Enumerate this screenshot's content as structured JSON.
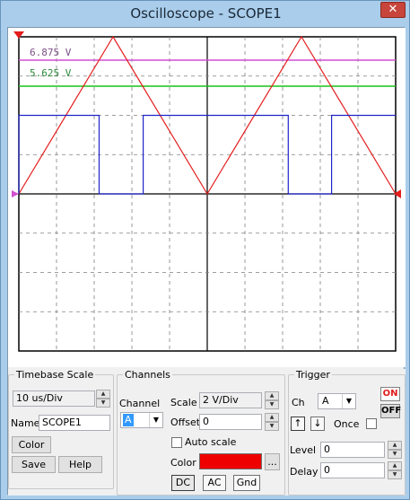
{
  "window": {
    "title": "Oscilloscope - SCOPE1",
    "close_glyph": "✕"
  },
  "screen": {
    "cursor_labels": [
      {
        "text": "6.875 V",
        "color": "#7a4f86"
      },
      {
        "text": "5.625 V",
        "color": "#2e8b3c"
      }
    ],
    "colors": {
      "background": "#ffffff",
      "grid": "#7f7f7f",
      "axis": "#000000",
      "triangle": "#e41c1c",
      "square": "#1f24c8",
      "cursor_top": "#d24fd0",
      "cursor_bottom": "#19c419"
    },
    "waveforms": {
      "triangle_peak_div": 4,
      "square_high_div": 2
    }
  },
  "timebase": {
    "legend": "Timebase Scale",
    "scale": "10 us/Div",
    "name_label": "Name",
    "name_value": "SCOPE1",
    "color_button": "Color",
    "save_button": "Save",
    "help_button": "Help"
  },
  "channels": {
    "legend": "Channels",
    "channel_label": "Channel",
    "channel_value": "A",
    "scale_label": "Scale",
    "scale_value": "2 V/Div",
    "offset_label": "Offset",
    "offset_value": "0",
    "autoscale_label": "Auto scale",
    "color_label": "Color",
    "color_value": "#ee0000",
    "ellipsis_button": "...",
    "coupling": [
      "DC",
      "AC",
      "Gnd"
    ]
  },
  "trigger": {
    "legend": "Trigger",
    "ch_label": "Ch",
    "ch_value": "A",
    "on_label": "ON",
    "off_label": "OFF",
    "rising_glyph": "↑",
    "falling_glyph": "↓",
    "once_label": "Once",
    "level_label": "Level",
    "level_value": "0",
    "delay_label": "Delay",
    "delay_value": "0"
  }
}
